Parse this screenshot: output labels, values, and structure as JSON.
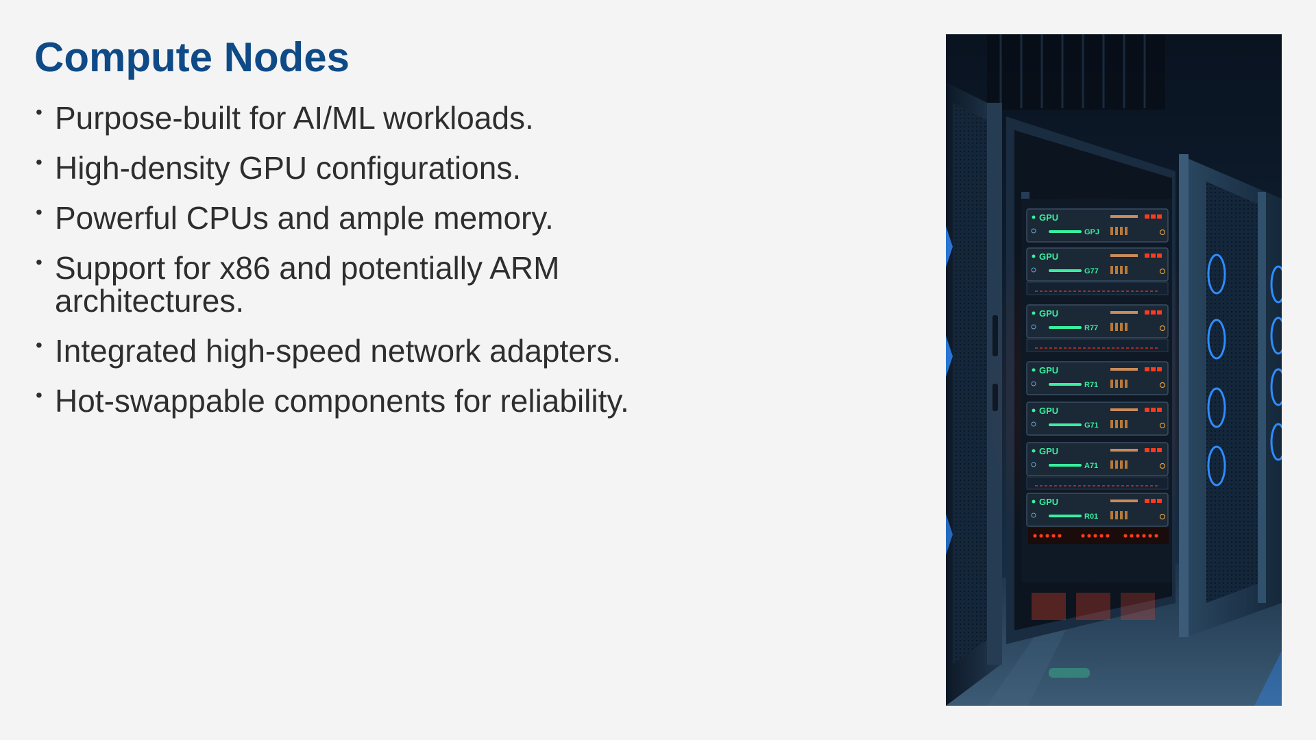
{
  "slide": {
    "title": "Compute Nodes",
    "bullets": [
      "Purpose-built for AI/ML workloads.",
      "High-density GPU configurations.",
      "Powerful CPUs and ample memory.",
      "Support for x86 and potentially ARM architectures.",
      "Integrated high-speed network adapters.",
      "Hot-swappable components for reliability."
    ],
    "bullet_symbol": "•"
  },
  "image": {
    "icon": "server-rack-photo",
    "server_label": "GPU",
    "module_codes": [
      "GPJ",
      "G77",
      "R77",
      "R71",
      "G71",
      "A71",
      "R01"
    ]
  },
  "colors": {
    "title": "#0e4a86",
    "text": "#2e2e2e",
    "background": "#f4f4f4",
    "gpu_green": "#38f0a0",
    "led_red": "#ff3b1f",
    "glow_blue": "#2f8cff"
  }
}
